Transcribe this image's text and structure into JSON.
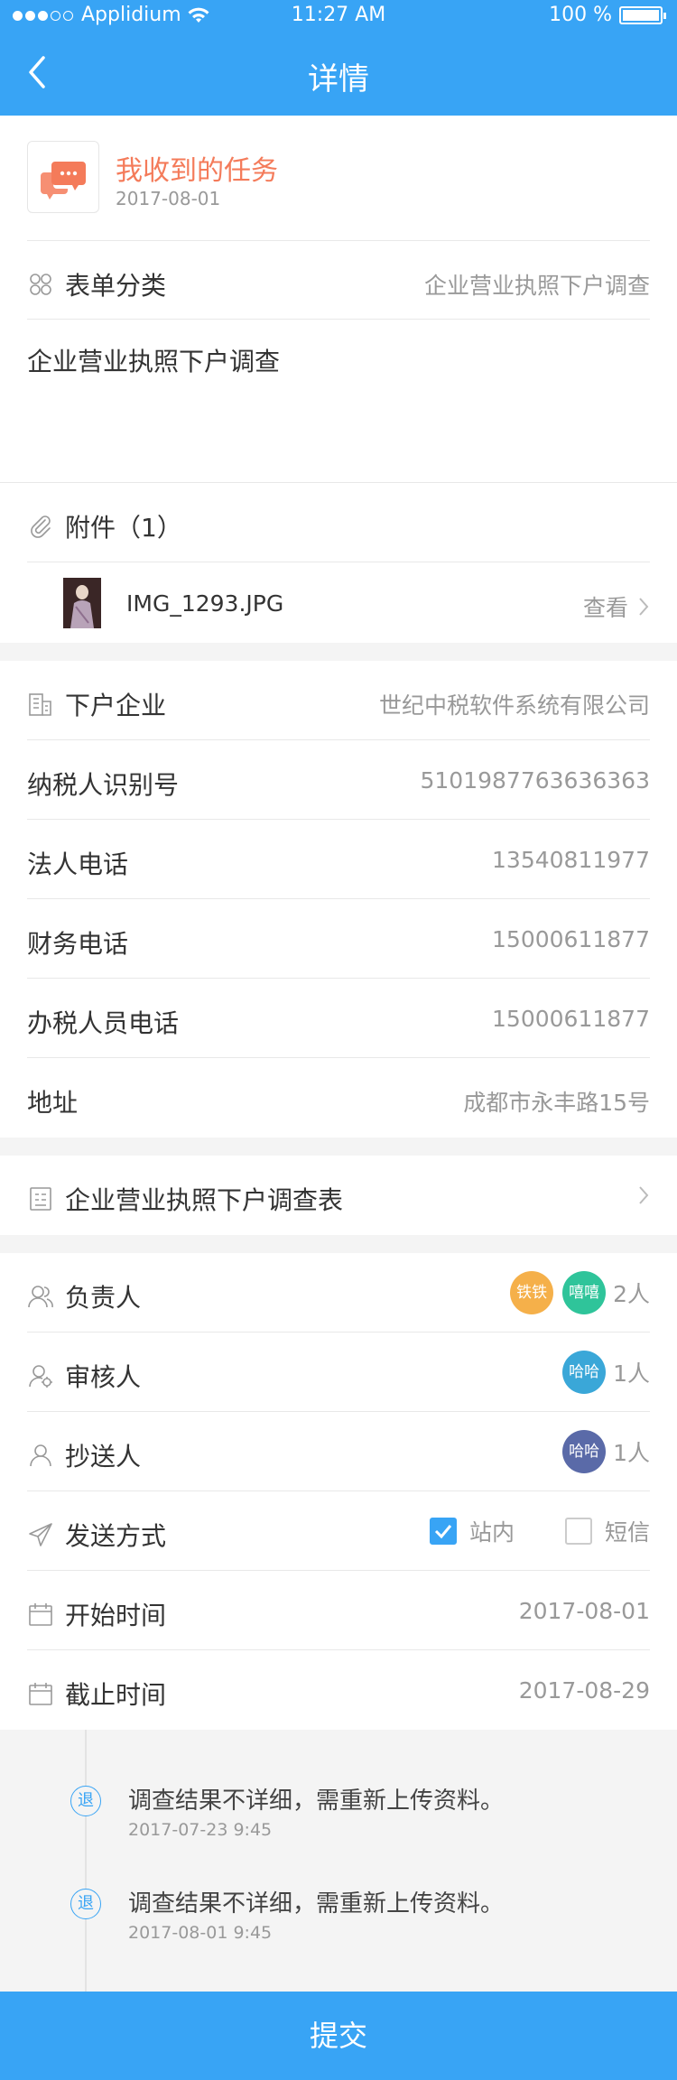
{
  "status_bar": {
    "carrier": "Applidium",
    "time": "11:27 AM",
    "battery": "100 %"
  },
  "nav": {
    "title": "详情"
  },
  "task": {
    "title": "我收到的任务",
    "date": "2017-08-01"
  },
  "form_category": {
    "label": "表单分类",
    "value": "企业营业执照下户调查"
  },
  "description": "企业营业执照下户调查",
  "attachments": {
    "label": "附件（1）",
    "file_name": "IMG_1293.JPG",
    "view_label": "查看"
  },
  "company": [
    {
      "label": "下户企业",
      "value": "世纪中税软件系统有限公司"
    },
    {
      "label": "纳税人识别号",
      "value": "5101987763636363"
    },
    {
      "label": "法人电话",
      "value": "13540811977"
    },
    {
      "label": "财务电话",
      "value": "15000611877"
    },
    {
      "label": "办税人员电话",
      "value": "15000611877"
    },
    {
      "label": "地址",
      "value": "成都市永丰路15号"
    }
  ],
  "survey_form": {
    "label": "企业营业执照下户调查表"
  },
  "people": {
    "owner": {
      "label": "负责人",
      "avatars": [
        "铁铁",
        "嘻嘻"
      ],
      "count": "2人"
    },
    "reviewer": {
      "label": "审核人",
      "avatars": [
        "哈哈"
      ],
      "count": "1人"
    },
    "cc": {
      "label": "抄送人",
      "avatars": [
        "哈哈"
      ],
      "count": "1人"
    }
  },
  "send_method": {
    "label": "发送方式",
    "options": [
      {
        "label": "站内",
        "checked": true
      },
      {
        "label": "短信",
        "checked": false
      }
    ]
  },
  "start_time": {
    "label": "开始时间",
    "value": "2017-08-01"
  },
  "end_time": {
    "label": "截止时间",
    "value": "2017-08-29"
  },
  "timeline": [
    {
      "badge": "退",
      "text": "调查结果不详细，需重新上传资料。",
      "date": "2017-07-23 9:45"
    },
    {
      "badge": "退",
      "text": "调查结果不详细，需重新上传资料。",
      "date": "2017-08-01 9:45"
    }
  ],
  "submit_label": "提交",
  "colors": {
    "primary": "#38a4f5",
    "accent": "#f47b5a",
    "avatar_orange": "#f5b04a",
    "avatar_green": "#2fc49a",
    "avatar_blue": "#3aa7d8",
    "avatar_indigo": "#5a6aa8"
  }
}
